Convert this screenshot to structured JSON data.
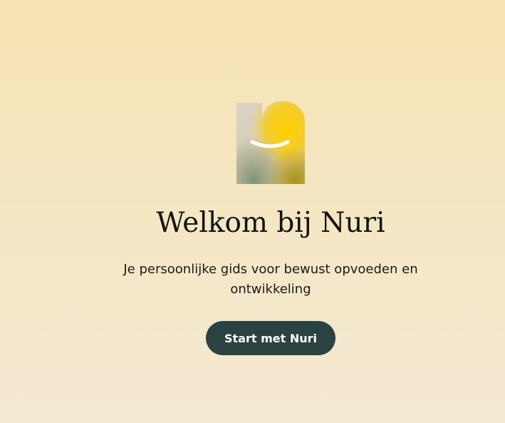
{
  "welcome": {
    "logo_icon": "nuri-smile-logo",
    "title": "Welkom bij Nuri",
    "subtitle": "Je persoonlijke gids voor bewust opvoeden en ontwikkeling",
    "cta_label": "Start met Nuri"
  },
  "colors": {
    "background_top": "#f6e2b3",
    "background_bottom": "#f4e9d3",
    "button_bg": "#2b4242",
    "button_text": "#ffffff",
    "title_text": "#16130f",
    "logo_yellow": "#ffcf0a",
    "logo_grey": "#d9d1c7"
  }
}
